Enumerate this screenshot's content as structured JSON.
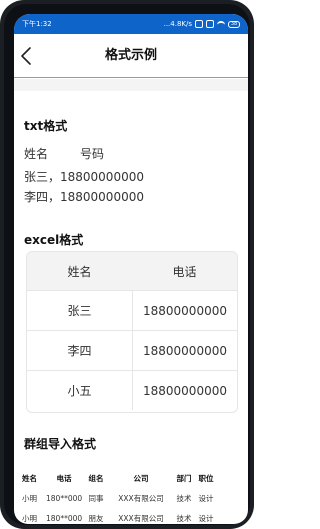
{
  "status_bar": {
    "time": "下午1:32",
    "network_speed": "...4.8K/s",
    "battery": "38"
  },
  "nav": {
    "title": "格式示例"
  },
  "txt_section": {
    "title": "txt格式",
    "header_name": "姓名",
    "header_phone": "号码",
    "lines": [
      "张三，18800000000",
      "李四，18800000000"
    ]
  },
  "excel_section": {
    "title": "excel格式",
    "headers": [
      "姓名",
      "电话"
    ],
    "rows": [
      [
        "张三",
        "18800000000"
      ],
      [
        "李四",
        "18800000000"
      ],
      [
        "小五",
        "18800000000"
      ]
    ]
  },
  "group_section": {
    "title": "群组导入格式",
    "headers": [
      "姓名",
      "电话",
      "组名",
      "公司",
      "部门",
      "职位"
    ],
    "rows": [
      [
        "小明",
        "180**000",
        "同事",
        "XXX有限公司",
        "技术",
        "设计"
      ],
      [
        "小明",
        "180**000",
        "朋友",
        "XXX有限公司",
        "技术",
        "设计"
      ]
    ]
  }
}
